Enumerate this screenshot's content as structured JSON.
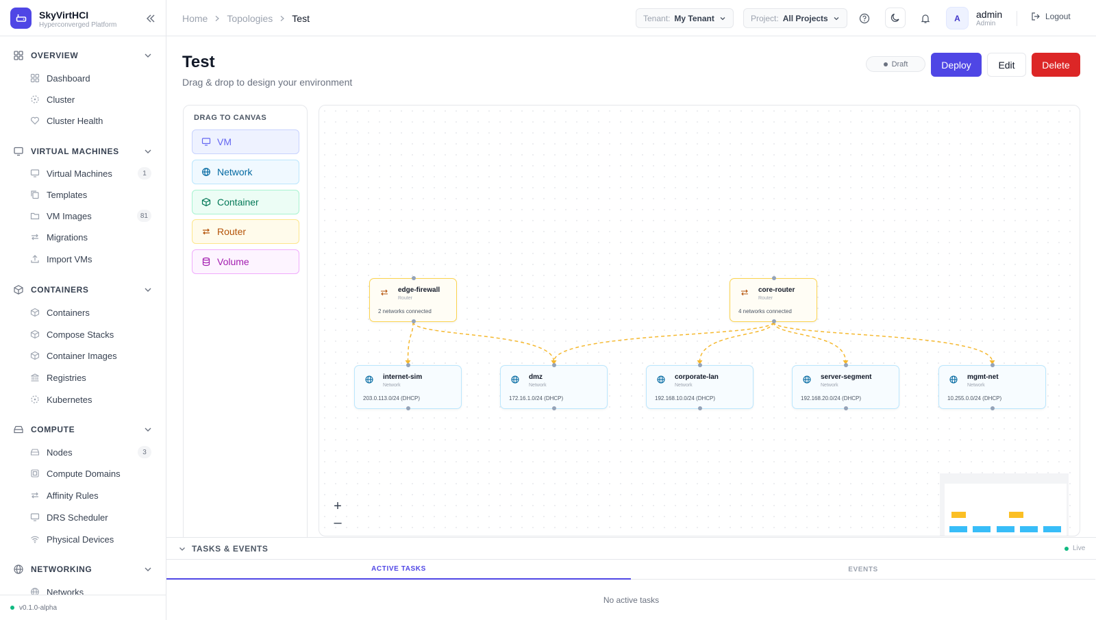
{
  "brand": {
    "name": "SkyVirtHCI",
    "subtitle": "Hyperconverged Platform"
  },
  "nav": {
    "sections": [
      {
        "label": "OVERVIEW",
        "icon": "grid-icon",
        "items": [
          {
            "label": "Dashboard",
            "icon": "grid-icon"
          },
          {
            "label": "Cluster",
            "icon": "cluster-icon"
          },
          {
            "label": "Cluster Health",
            "icon": "heart-icon"
          }
        ]
      },
      {
        "label": "VIRTUAL MACHINES",
        "icon": "monitor-icon",
        "items": [
          {
            "label": "Virtual Machines",
            "icon": "monitor-icon",
            "badge": "1"
          },
          {
            "label": "Templates",
            "icon": "copy-icon"
          },
          {
            "label": "VM Images",
            "icon": "folder-icon",
            "badge": "81"
          },
          {
            "label": "Migrations",
            "icon": "arrows-icon"
          },
          {
            "label": "Import VMs",
            "icon": "upload-icon"
          }
        ]
      },
      {
        "label": "CONTAINERS",
        "icon": "box-icon",
        "items": [
          {
            "label": "Containers",
            "icon": "box-icon"
          },
          {
            "label": "Compose Stacks",
            "icon": "box-icon"
          },
          {
            "label": "Container Images",
            "icon": "box-icon"
          },
          {
            "label": "Registries",
            "icon": "bank-icon"
          },
          {
            "label": "Kubernetes",
            "icon": "cluster-icon"
          }
        ]
      },
      {
        "label": "COMPUTE",
        "icon": "server-icon",
        "items": [
          {
            "label": "Nodes",
            "icon": "server-icon",
            "badge": "3"
          },
          {
            "label": "Compute Domains",
            "icon": "cpu-icon"
          },
          {
            "label": "Affinity Rules",
            "icon": "arrows-icon"
          },
          {
            "label": "DRS Scheduler",
            "icon": "monitor-icon"
          },
          {
            "label": "Physical Devices",
            "icon": "wifi-icon"
          }
        ]
      },
      {
        "label": "NETWORKING",
        "icon": "globe-icon",
        "items": [
          {
            "label": "Networks",
            "icon": "globe-icon"
          }
        ]
      }
    ]
  },
  "version": "v0.1.0-alpha",
  "breadcrumb": [
    "Home",
    "Topologies",
    "Test"
  ],
  "header": {
    "tenant_key": "Tenant:",
    "tenant_value": "My Tenant",
    "project_key": "Project:",
    "project_value": "All Projects",
    "avatar_letter": "A",
    "user_name": "admin",
    "user_role": "Admin",
    "logout": "Logout"
  },
  "page": {
    "title": "Test",
    "subtitle": "Drag & drop to design your environment",
    "status": "Draft",
    "deploy": "Deploy",
    "edit": "Edit",
    "delete": "Delete"
  },
  "palette": {
    "title": "DRAG TO CANVAS",
    "items": [
      {
        "label": "VM",
        "icon": "monitor-icon",
        "color": "#6366f1",
        "bg": "#eef2ff",
        "border": "#c7d2fe"
      },
      {
        "label": "Network",
        "icon": "globe-icon",
        "color": "#0369a1",
        "bg": "#f0f9ff",
        "border": "#bae6fd"
      },
      {
        "label": "Container",
        "icon": "box-icon",
        "color": "#047857",
        "bg": "#ecfdf5",
        "border": "#a7f3d0"
      },
      {
        "label": "Router",
        "icon": "arrows-icon",
        "color": "#b45309",
        "bg": "#fffbeb",
        "border": "#fde68a"
      },
      {
        "label": "Volume",
        "icon": "database-icon",
        "color": "#a21caf",
        "bg": "#fdf4ff",
        "border": "#f0abfc"
      }
    ]
  },
  "topology": {
    "routers": [
      {
        "name": "edge-firewall",
        "type": "Router",
        "detail": "2 networks connected"
      },
      {
        "name": "core-router",
        "type": "Router",
        "detail": "4 networks connected"
      }
    ],
    "networks": [
      {
        "name": "internet-sim",
        "type": "Network",
        "detail": "203.0.113.0/24 (DHCP)"
      },
      {
        "name": "dmz",
        "type": "Network",
        "detail": "172.16.1.0/24 (DHCP)"
      },
      {
        "name": "corporate-lan",
        "type": "Network",
        "detail": "192.168.10.0/24 (DHCP)"
      },
      {
        "name": "server-segment",
        "type": "Network",
        "detail": "192.168.20.0/24 (DHCP)"
      },
      {
        "name": "mgmt-net",
        "type": "Network",
        "detail": "10.255.0.0/24 (DHCP)"
      }
    ],
    "links": [
      [
        "edge-firewall",
        "internet-sim"
      ],
      [
        "edge-firewall",
        "dmz"
      ],
      [
        "core-router",
        "dmz"
      ],
      [
        "core-router",
        "corporate-lan"
      ],
      [
        "core-router",
        "server-segment"
      ],
      [
        "core-router",
        "mgmt-net"
      ]
    ],
    "zoom_in": "+",
    "zoom_out": "–",
    "colors": {
      "router": "#fbbf24",
      "network": "#38bdf8",
      "edge": "#f5b82e"
    }
  },
  "tasks": {
    "title": "TASKS & EVENTS",
    "live": "Live",
    "tabs": [
      "ACTIVE TASKS",
      "EVENTS"
    ],
    "empty": "No active tasks"
  }
}
